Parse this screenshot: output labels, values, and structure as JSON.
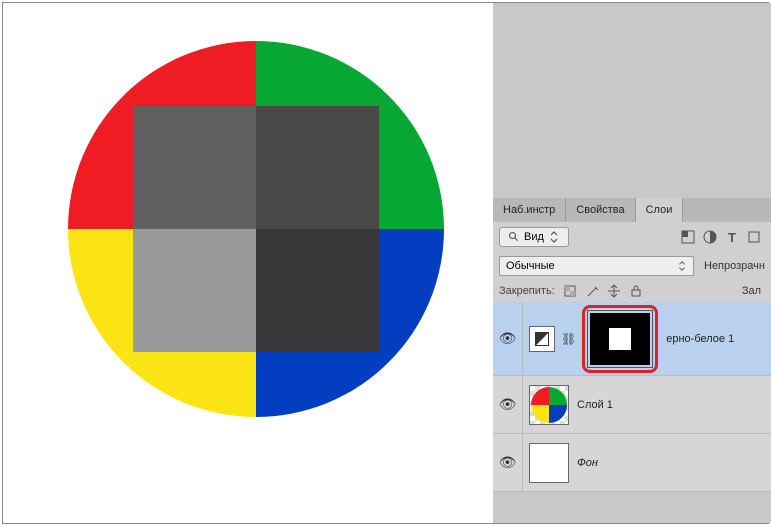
{
  "tabs": {
    "tools": "Наб.инстр",
    "properties": "Свойства",
    "layers": "Слои"
  },
  "filter": {
    "kind_label": "Вид"
  },
  "blend_mode": "Обычные",
  "opacity_label": "Непрозрачн",
  "lock_label": "Закрепить:",
  "fill_label": "Зал",
  "layers": {
    "adjustment_name": "ерно-белое 1",
    "layer1_name": "Слой 1",
    "bg_name": "Фон"
  }
}
